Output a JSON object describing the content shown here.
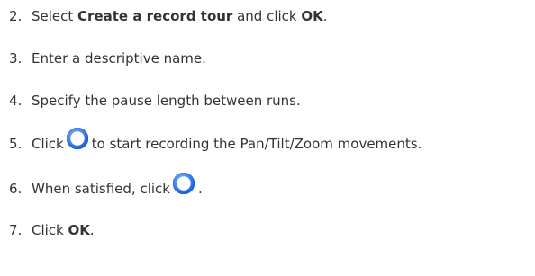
{
  "steps": [
    {
      "number": "2.",
      "pre": "Select ",
      "bold1": "Create a record tour",
      "mid": " and click ",
      "bold2": "OK",
      "post": "."
    },
    {
      "number": "3.",
      "text": "Enter a descriptive name."
    },
    {
      "number": "4.",
      "text": "Specify the pause length between runs."
    },
    {
      "number": "5.",
      "pre": "Click",
      "icon": "record-circle-icon",
      "post": " to start recording the Pan/Tilt/Zoom movements."
    },
    {
      "number": "6.",
      "pre": "When satisfied, click",
      "icon": "stop-rounded-square-icon",
      "post": "."
    },
    {
      "number": "7.",
      "pre": "Click ",
      "bold1": "OK",
      "post": "."
    }
  ],
  "colors": {
    "text": "#333333",
    "icon_blue": "#1e63d6",
    "icon_light": "#8fc0ff"
  }
}
